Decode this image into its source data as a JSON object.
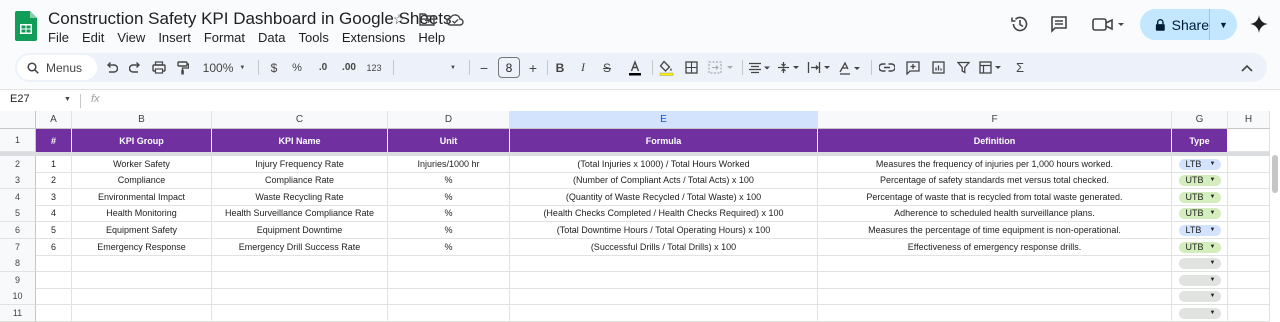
{
  "doc": {
    "title": "Construction Safety KPI Dashboard in Google Sheets",
    "menu": [
      "File",
      "Edit",
      "View",
      "Insert",
      "Format",
      "Data",
      "Tools",
      "Extensions",
      "Help"
    ],
    "share_label": "Share"
  },
  "toolbar": {
    "search_label": "Menus",
    "zoom": "100%",
    "currency": "$",
    "percent": "%",
    "dec_decrease": ".0",
    "dec_increase": ".00",
    "number_format": "123",
    "font_size": "8"
  },
  "formula_bar": {
    "cell_ref": "E27",
    "fx_label": "fx"
  },
  "columns": [
    "A",
    "B",
    "C",
    "D",
    "E",
    "F",
    "G",
    "H"
  ],
  "selected_column": "E",
  "header_row": [
    "#",
    "KPI Group",
    "KPI Name",
    "Unit",
    "Formula",
    "Definition",
    "Type"
  ],
  "rows": [
    {
      "num": "1",
      "group": "Worker Safety",
      "name": "Injury Frequency Rate",
      "unit": "Injuries/1000 hr",
      "formula": "(Total Injuries x 1000) / Total Hours Worked",
      "definition": "Measures the frequency of injuries per 1,000 hours worked.",
      "type": "LTB"
    },
    {
      "num": "2",
      "group": "Compliance",
      "name": "Compliance Rate",
      "unit": "%",
      "formula": "(Number of Compliant Acts / Total Acts) x 100",
      "definition": "Percentage of safety standards met versus total checked.",
      "type": "UTB"
    },
    {
      "num": "3",
      "group": "Environmental Impact",
      "name": "Waste Recycling Rate",
      "unit": "%",
      "formula": "(Quantity of Waste Recycled / Total Waste) x 100",
      "definition": "Percentage of waste that is recycled from total waste generated.",
      "type": "UTB"
    },
    {
      "num": "4",
      "group": "Health Monitoring",
      "name": "Health Surveillance Compliance Rate",
      "unit": "%",
      "formula": "(Health Checks Completed / Health Checks Required) x 100",
      "definition": "Adherence to scheduled health surveillance plans.",
      "type": "UTB"
    },
    {
      "num": "5",
      "group": "Equipment Safety",
      "name": "Equipment Downtime",
      "unit": "%",
      "formula": "(Total Downtime Hours / Total Operating Hours) x 100",
      "definition": "Measures the percentage of time equipment is non-operational.",
      "type": "LTB"
    },
    {
      "num": "6",
      "group": "Emergency Response",
      "name": "Emergency Drill Success Rate",
      "unit": "%",
      "formula": "(Successful Drills / Total Drills) x 100",
      "definition": "Effectiveness of emergency response drills.",
      "type": "UTB"
    }
  ],
  "row_numbers": [
    "1",
    "2",
    "3",
    "4",
    "5",
    "6",
    "7",
    "8",
    "9",
    "10",
    "11"
  ],
  "colors": {
    "header_fill": "#7030a0",
    "ltb_chip": "#d3e3fd",
    "utb_chip": "#d4edbc",
    "empty_chip": "#e1e3e1"
  }
}
